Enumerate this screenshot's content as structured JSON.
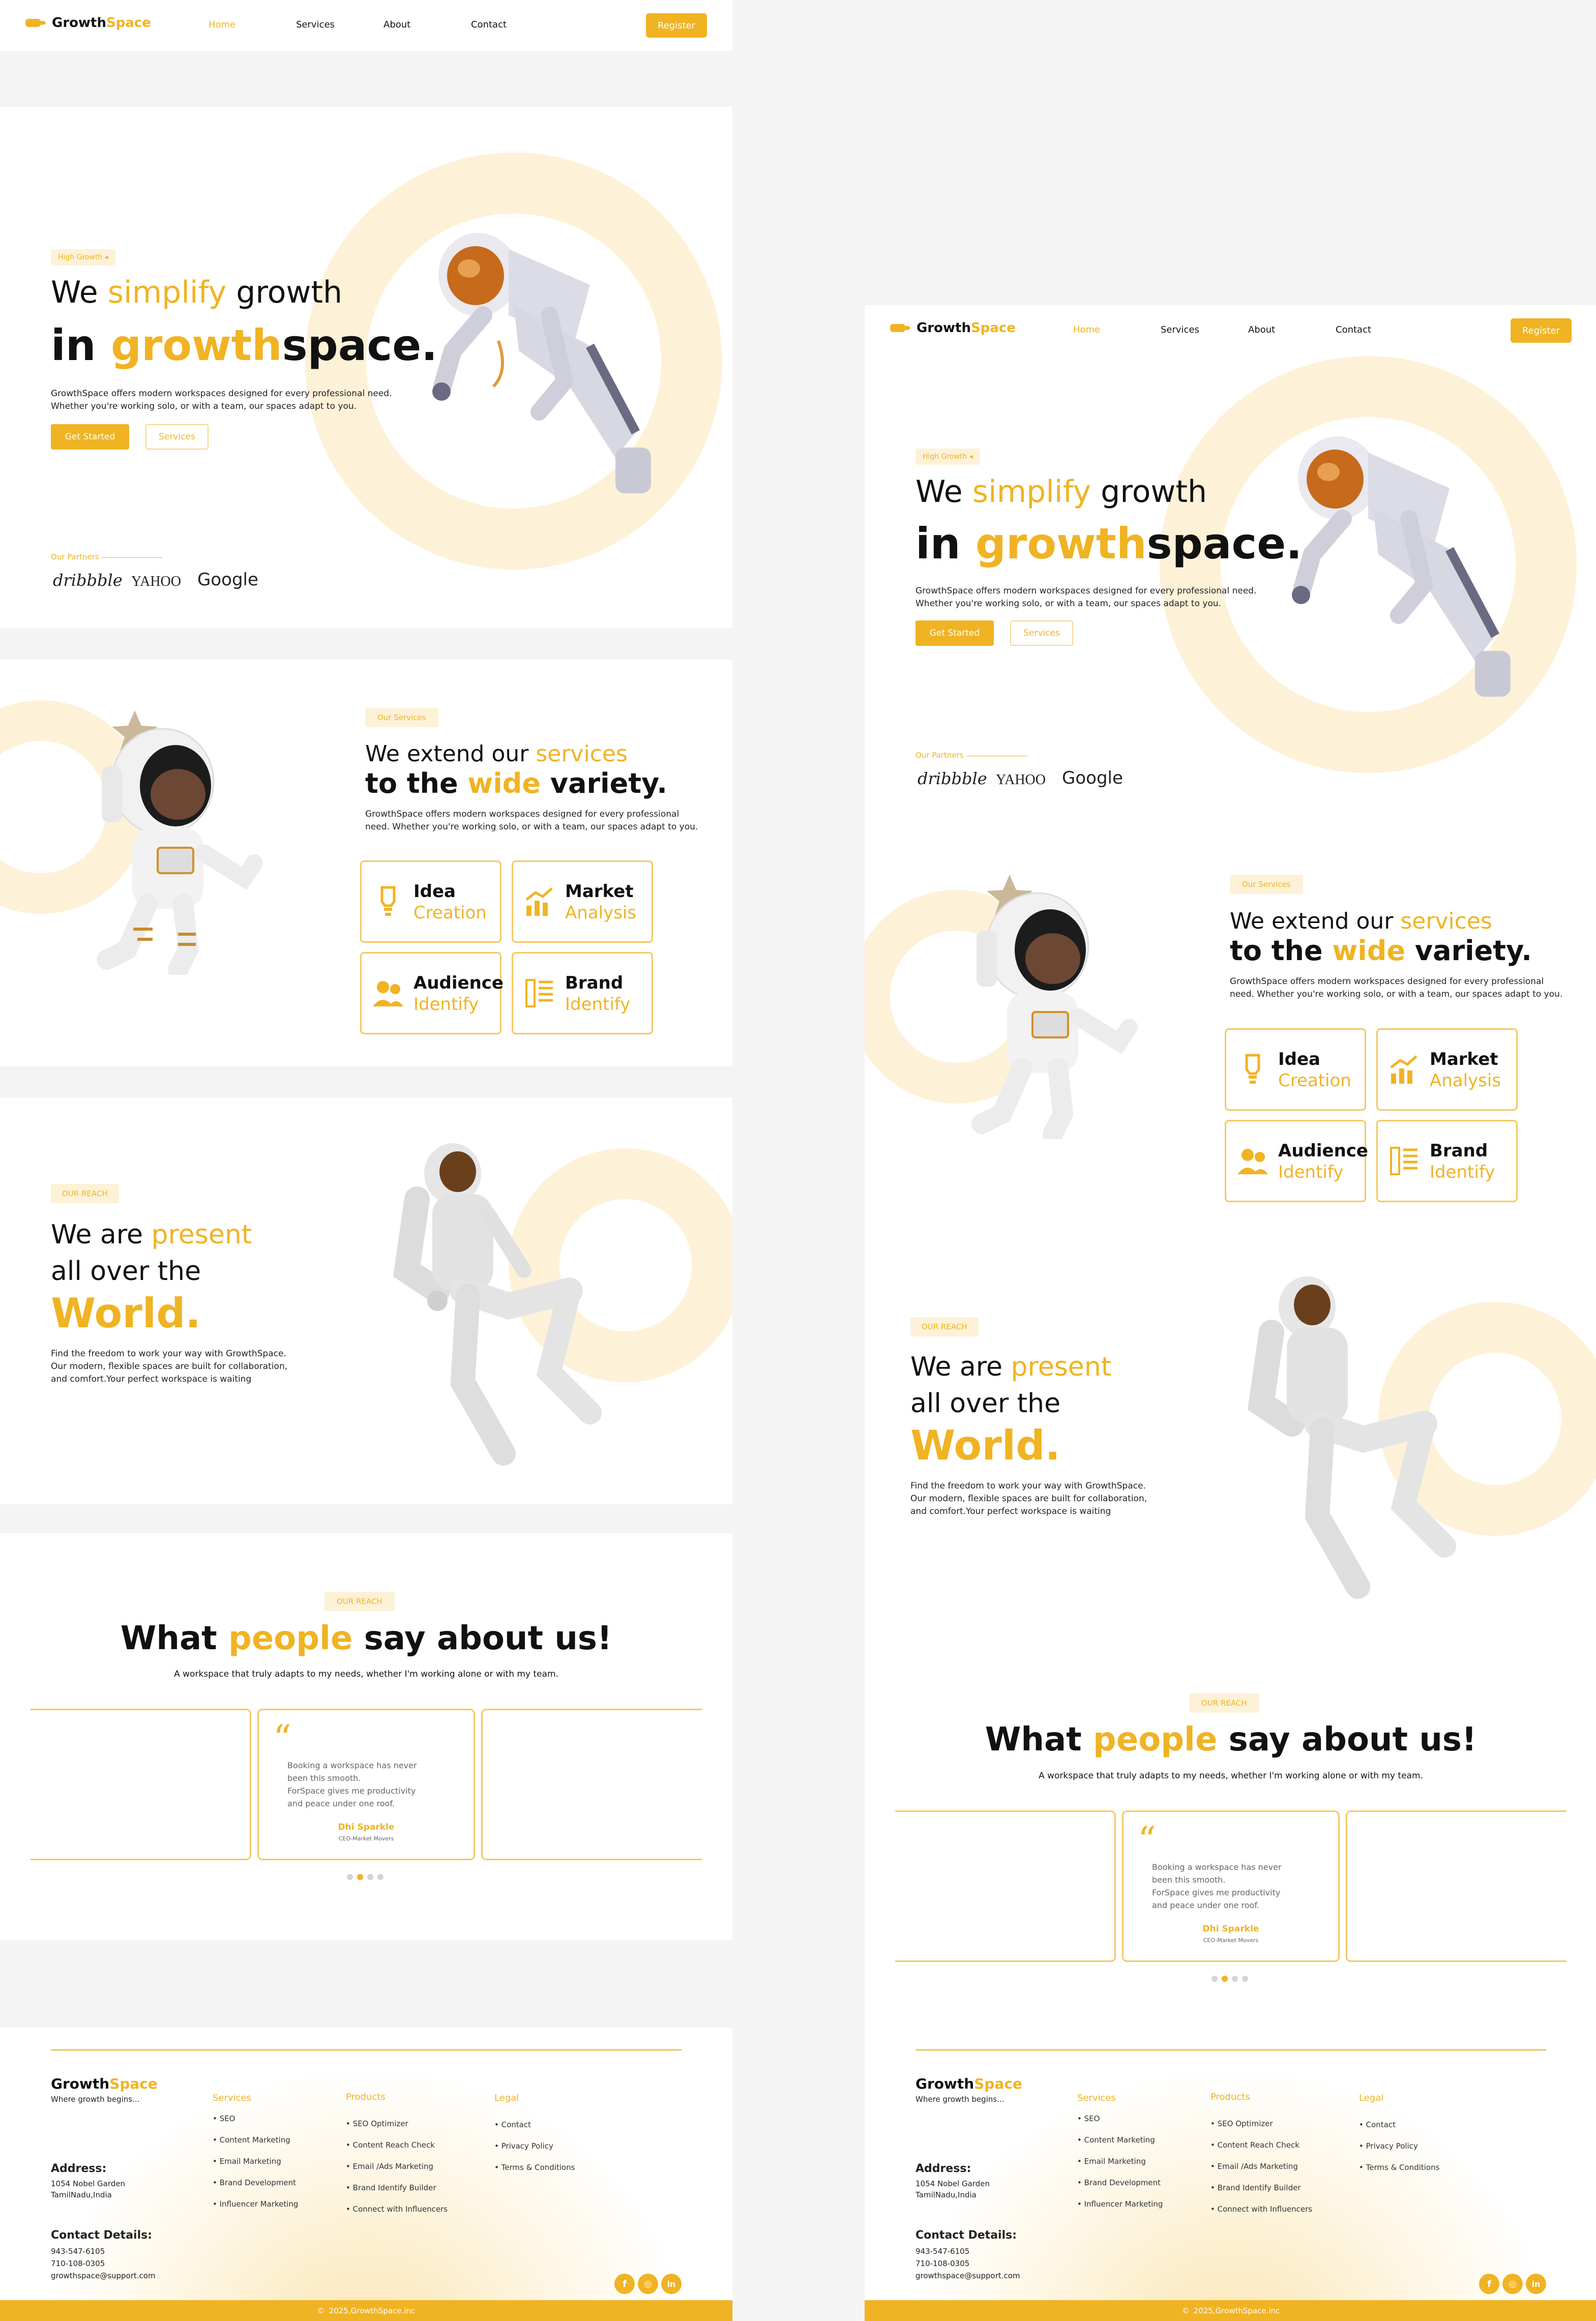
{
  "brand": {
    "name_a": "Growth",
    "name_b": "Space",
    "tagline": "Where growth begins..."
  },
  "nav": {
    "links": [
      "Home",
      "Services",
      "About",
      "Contact"
    ],
    "register": "Register"
  },
  "hero": {
    "badge": "High Growth",
    "line1_a": "We ",
    "line1_b": "simplify",
    "line1_c": " growth",
    "line2_a": "in ",
    "line2_b": "growth",
    "line2_c": "space.",
    "para1": "GrowthSpace offers  modern workspaces designed for every professional need.",
    "para2": "Whether you're working solo, or with a team, our spaces adapt to you.",
    "btn_primary": "Get Started",
    "btn_secondary": "Services",
    "partners_label": "Our Partners",
    "partners": [
      "dribbble",
      "YAHOO",
      "Google"
    ]
  },
  "services": {
    "badge": "Our Services",
    "h1_a": "We extend our ",
    "h1_b": "services",
    "h2_a": "to the ",
    "h2_b": "wide",
    "h2_c": " variety.",
    "para1": "GrowthSpace offers  modern workspaces designed for every professional",
    "para2": "need. Whether you're working solo, or with a team, our spaces adapt to you.",
    "cards": [
      {
        "a": "Idea",
        "b": "Creation",
        "icon": "lightbulb-icon"
      },
      {
        "a": "Market",
        "b": "Analysis",
        "icon": "chart-icon"
      },
      {
        "a": "Audience",
        "b": "Identify",
        "icon": "users-icon"
      },
      {
        "a": "Brand",
        "b": "Identify",
        "icon": "list-icon"
      }
    ]
  },
  "reach": {
    "badge": "OUR REACH",
    "l1_a": "We are ",
    "l1_b": "present",
    "l2": "all over the",
    "l3": "World.",
    "para1": "Find the freedom to work your way with GrowthSpace.",
    "para2": "Our modern, flexible spaces are built for collaboration,",
    "para3": "and comfort.Your perfect workspace is waiting"
  },
  "testimonials": {
    "badge": "OUR REACH",
    "h_a": "What ",
    "h_b": "people",
    "h_c": " say about us!",
    "sub": "A workspace that truly adapts to my needs, whether I'm working alone or with my team.",
    "quote_mark": "“",
    "q1": "Booking a workspace has never",
    "q2": "been this smooth.",
    "q3": " ForSpace gives me productivity",
    "q4": "and peace under one roof.",
    "name": "Dhi Sparkle",
    "role": "CEO-Market Movers",
    "active_dot": 1
  },
  "footer": {
    "services_h": "Services",
    "services": [
      "SEO",
      "Content Marketing",
      "Email Marketing",
      "Brand Development",
      "Influencer Marketing"
    ],
    "products_h": "Products",
    "products": [
      "SEO Optimizer",
      "Content Reach Check",
      "Email /Ads Marketing",
      "Brand Identify Builder",
      "Connect with Influencers"
    ],
    "legal_h": "Legal",
    "legal": [
      "Contact",
      "Privacy Policy",
      "Terms & Conditions"
    ],
    "address_h": "Address:",
    "address1": "1054 Nobel Garden",
    "address2": "TamilNadu,India",
    "contact_h": "Contact Details:",
    "phone1": "943-547-6105",
    "phone2": "710-108-0305",
    "email": "growthspace@support.com",
    "copyright": "2025,GrowthSpace.inc",
    "copy_symbol": "©",
    "socials": [
      "facebook-icon",
      "instagram-icon",
      "linkedin-icon"
    ],
    "social_glyphs": [
      "f",
      "◎",
      "in"
    ]
  },
  "colors": {
    "accent": "#f0b323",
    "accent_light": "#fdf2d8"
  }
}
